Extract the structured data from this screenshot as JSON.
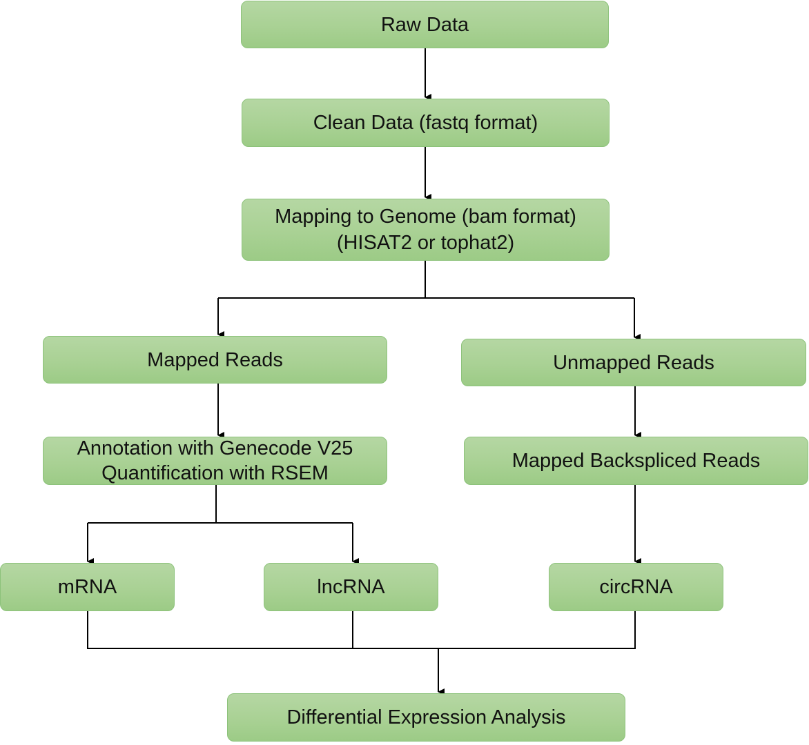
{
  "diagram": {
    "type": "flowchart",
    "colors": {
      "node_fill_top": "#b5d7a3",
      "node_fill_bottom": "#9ccb86",
      "node_border": "#8cc27a",
      "edge": "#000000",
      "text": "#111111"
    },
    "nodes": {
      "raw_data": {
        "lines": [
          "Raw Data"
        ]
      },
      "clean_data": {
        "lines": [
          "Clean Data (fastq format)"
        ]
      },
      "mapping": {
        "lines": [
          "Mapping to Genome (bam format)",
          "(HISAT2 or tophat2)"
        ]
      },
      "mapped_reads": {
        "lines": [
          "Mapped Reads"
        ]
      },
      "unmapped_reads": {
        "lines": [
          "Unmapped Reads"
        ]
      },
      "annotation": {
        "lines": [
          "Annotation with Genecode V25",
          "Quantification with RSEM"
        ]
      },
      "backspliced": {
        "lines": [
          "Mapped Backspliced Reads"
        ]
      },
      "mrna": {
        "lines": [
          "mRNA"
        ]
      },
      "lncrna": {
        "lines": [
          "lncRNA"
        ]
      },
      "circrna": {
        "lines": [
          "circRNA"
        ]
      },
      "dea": {
        "lines": [
          "Differential Expression Analysis"
        ]
      }
    },
    "edges": [
      {
        "from": "raw_data",
        "to": "clean_data"
      },
      {
        "from": "clean_data",
        "to": "mapping"
      },
      {
        "from": "mapping",
        "to": "mapped_reads"
      },
      {
        "from": "mapping",
        "to": "unmapped_reads"
      },
      {
        "from": "mapped_reads",
        "to": "annotation"
      },
      {
        "from": "unmapped_reads",
        "to": "backspliced"
      },
      {
        "from": "annotation",
        "to": "mrna"
      },
      {
        "from": "annotation",
        "to": "lncrna"
      },
      {
        "from": "backspliced",
        "to": "circrna"
      },
      {
        "from": "mrna",
        "to": "dea"
      },
      {
        "from": "lncrna",
        "to": "dea"
      },
      {
        "from": "circrna",
        "to": "dea"
      }
    ]
  }
}
